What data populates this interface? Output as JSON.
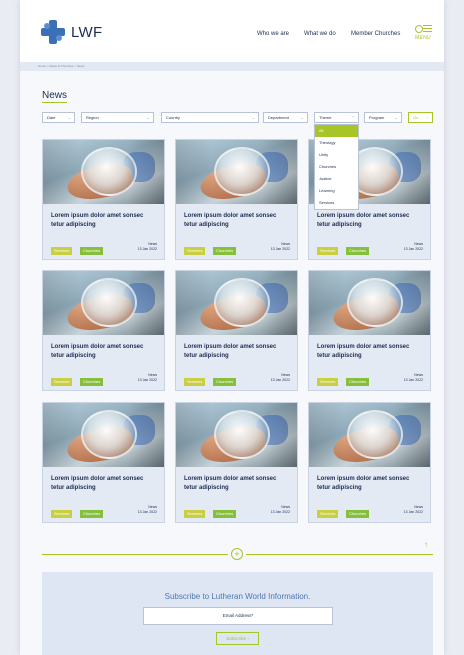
{
  "header": {
    "logo_text": "LWF",
    "nav": [
      "Who we are",
      "What we do",
      "Member Churches"
    ],
    "menu_label": "MENU"
  },
  "breadcrumb": "Home > News & Churches > News",
  "page_title": "News",
  "filters": {
    "date": "Date",
    "region": "Region",
    "country": "Country",
    "department": "Department",
    "theme": "Theme",
    "program": "Program",
    "go": "Go"
  },
  "theme_dropdown": {
    "options": [
      "All",
      "Theology",
      "Unity",
      "Churches",
      "Justice",
      "Learning",
      "Services"
    ],
    "selected": "All"
  },
  "cards": [
    {
      "title": "Lorem ipsum dolor amet sonsec tetur adipiscing",
      "tag1": "Services",
      "tag2": "Churches",
      "type": "News",
      "date": "13 Jan 2022"
    },
    {
      "title": "Lorem ipsum dolor amet sonsec tetur adipiscing",
      "tag1": "Services",
      "tag2": "Churches",
      "type": "News",
      "date": "13 Jan 2022"
    },
    {
      "title": "Lorem ipsum dolor amet sonsec tetur adipiscing",
      "tag1": "Services",
      "tag2": "Churches",
      "type": "News",
      "date": "13 Jan 2022"
    },
    {
      "title": "Lorem ipsum dolor amet sonsec tetur adipiscing",
      "tag1": "Services",
      "tag2": "Churches",
      "type": "News",
      "date": "13 Jan 2022"
    },
    {
      "title": "Lorem ipsum dolor amet sonsec tetur adipiscing",
      "tag1": "Services",
      "tag2": "Churches",
      "type": "News",
      "date": "13 Jan 2022"
    },
    {
      "title": "Lorem ipsum dolor amet sonsec tetur adipiscing",
      "tag1": "Services",
      "tag2": "Churches",
      "type": "News",
      "date": "13 Jan 2022"
    },
    {
      "title": "Lorem ipsum dolor amet sonsec tetur adipiscing",
      "tag1": "Services",
      "tag2": "Churches",
      "type": "News",
      "date": "13 Jan 2022"
    },
    {
      "title": "Lorem ipsum dolor amet sonsec tetur adipiscing",
      "tag1": "Services",
      "tag2": "Churches",
      "type": "News",
      "date": "13 Jan 2022"
    },
    {
      "title": "Lorem ipsum dolor amet sonsec tetur adipiscing",
      "tag1": "Services",
      "tag2": "Churches",
      "type": "News",
      "date": "13 Jan 2022"
    }
  ],
  "load_more_icon": "plus-circle-icon",
  "subscribe": {
    "title": "Subscribe to Lutheran World Information.",
    "email_placeholder": "Email Address*",
    "button": "Subscribe"
  },
  "colors": {
    "brand_navy": "#1d2c52",
    "brand_blue": "#3b6fb6",
    "accent_green": "#a7c527",
    "tag_services": "#c9cf42",
    "tag_churches": "#86bf3b"
  }
}
